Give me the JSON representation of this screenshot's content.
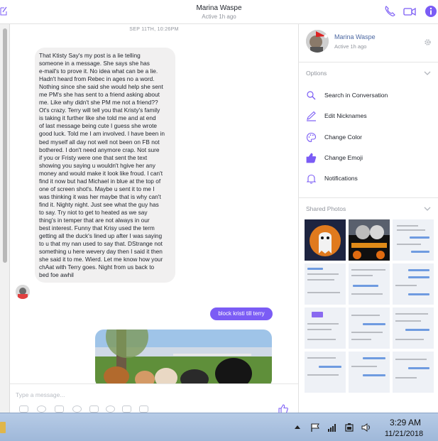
{
  "header": {
    "name": "Marina Waspe",
    "status": "Active 1h ago",
    "accent": "#7b5cf5"
  },
  "chat": {
    "date_separator": "SEP 11TH, 10:26PM",
    "incoming_message": "That Ktisty Say's my post is a lie telling\nsomeone in a message. She says she has\ne-mail's to prove it. No idea what can be a lie.\nHadn't heard from Rebec in ages no a word.\nNothing since she said she would help she sent\nme PM's she has sent to a friend asking about\nme. Like why didn't she PM me not a friend??\nOt's crazy. Terry will tell you that Kristy's family\nis taking it further like she told me and at end\nof last message being cute I guess she wrote\ngood luck. Told me I am involved. I have been in\nbed myself all day not well not been on FB not\nbothered. I don't need anymore crap. Not sure\nif you or Fristy were one that sent the text\nshowing you saying u wouldn't hgive her any\nmoney and would make it look like froud. I can't\nfind it now but had Michael in blue at the top of\none of screen shot's. Maybe u sent it to me I\nwas thinking it was her maybe that is why can't\nfind it. Nighty night. Just see what the guy has\nto say. Try niot to get to heated as we say\nthing's in temper that are not always in our\nbest interest. Funny that Krisy used the term\ngetting all the duck's lined up after I was saying\nto u that my nan used to say that. DStrange not\nsomething u here wevery day then I said it then\nshe said it to me. Wierd. Let me know how your\nchAat with Terry goes. Night from us back to\nbed foe awhil",
    "sent_message": "block kristi till terry"
  },
  "composer": {
    "placeholder": "Type a message..."
  },
  "panel": {
    "name": "Marina Waspe",
    "status": "Active 1h ago",
    "options_title": "Options",
    "options": [
      {
        "icon": "search-icon",
        "label": "Search in Conversation"
      },
      {
        "icon": "pencil-icon",
        "label": "Edit Nicknames"
      },
      {
        "icon": "palette-icon",
        "label": "Change Color"
      },
      {
        "icon": "thumbs-up-icon",
        "label": "Change Emoji"
      },
      {
        "icon": "bell-icon",
        "label": "Notifications"
      }
    ],
    "photos_title": "Shared Photos"
  },
  "taskbar": {
    "time": "3:29 AM",
    "date": "11/21/2018"
  }
}
